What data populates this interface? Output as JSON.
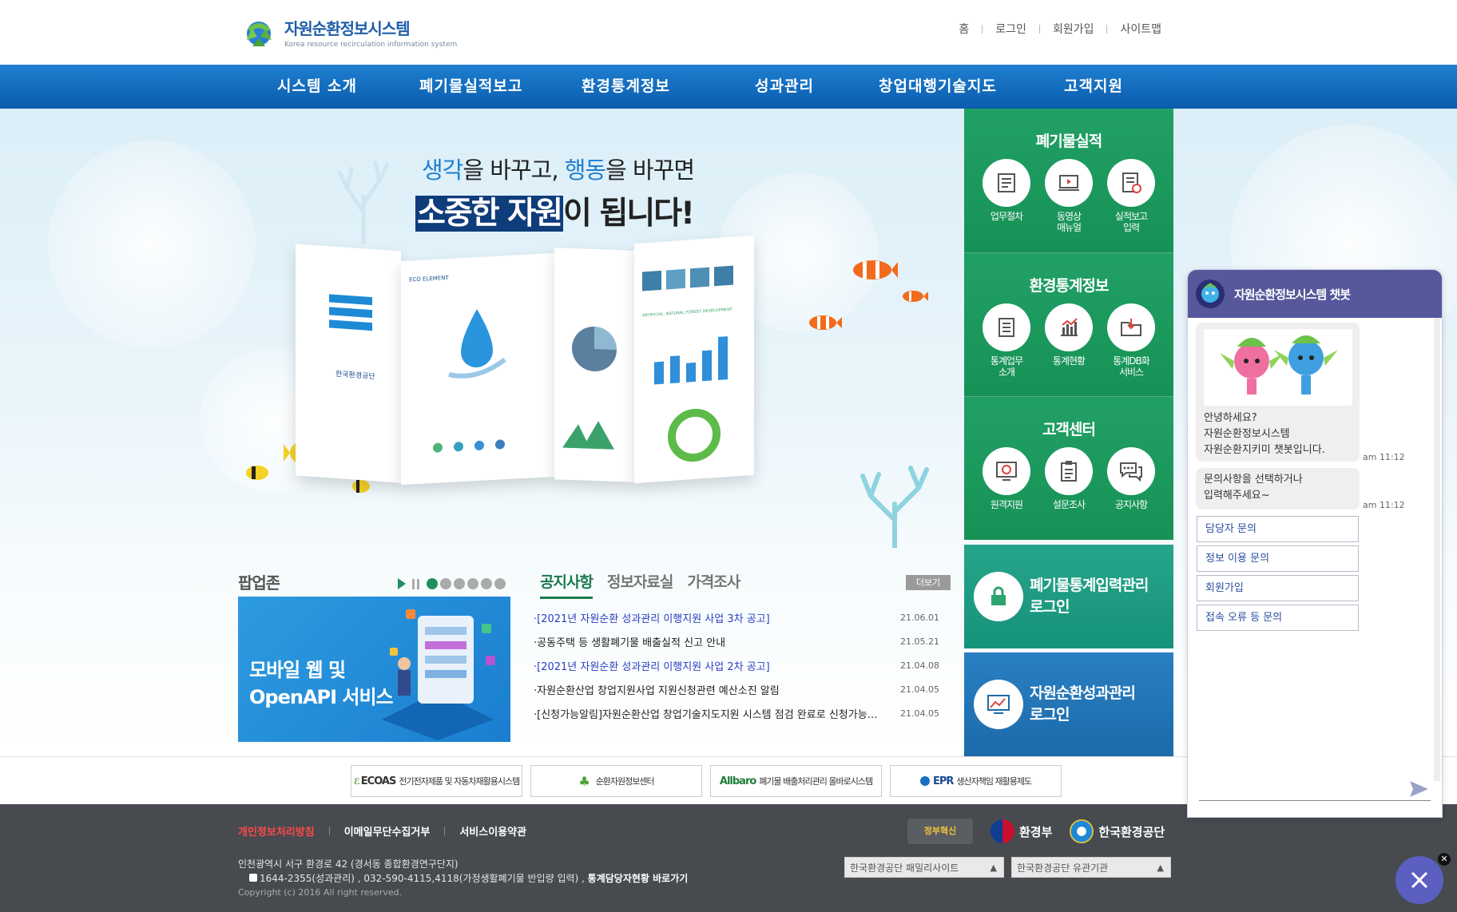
{
  "header": {
    "logo_title": "자원순환정보시스템",
    "logo_subtitle": "Korea resource recirculation information system",
    "util_links": [
      "홈",
      "로그인",
      "회원가입",
      "사이트맵"
    ]
  },
  "gnb": [
    "시스템 소개",
    "폐기물실적보고",
    "환경통계정보",
    "성과관리",
    "창업대행기술지도",
    "고객지원"
  ],
  "hero": {
    "line1_a": "생각",
    "line1_b": "을 바꾸고, ",
    "line1_c": "행동",
    "line1_d": "을 바꾸면",
    "line2_a": "소중한 자원",
    "line2_b": "이 됩니다!",
    "brochure_org": "한국환경공단",
    "brochure_heading": "ECO ELEMENT",
    "brochure_chart_title": "ARTIFICIAL, NATURAL FOREST DEVELOPMENT"
  },
  "quick": {
    "waste": {
      "title": "폐기물실적",
      "items": [
        {
          "label1": "업무절차",
          "label2": "",
          "icon": "document-icon"
        },
        {
          "label1": "동영상",
          "label2": "매뉴얼",
          "icon": "video-icon"
        },
        {
          "label1": "실적보고",
          "label2": "입력",
          "icon": "report-check-icon"
        }
      ]
    },
    "stats": {
      "title": "환경통계정보",
      "items": [
        {
          "label1": "통계업무",
          "label2": "소개",
          "icon": "notebook-icon"
        },
        {
          "label1": "통계현황",
          "label2": "",
          "icon": "bar-chart-icon"
        },
        {
          "label1": "통계DB화",
          "label2": "서비스",
          "icon": "folder-download-icon"
        }
      ]
    },
    "customer": {
      "title": "고객센터",
      "items": [
        {
          "label1": "원격지원",
          "label2": "",
          "icon": "remote-gear-icon"
        },
        {
          "label1": "설문조사",
          "label2": "",
          "icon": "clipboard-icon"
        },
        {
          "label1": "공지사항",
          "label2": "",
          "icon": "chat-bubbles-icon"
        }
      ]
    },
    "login1": {
      "line1": "폐기물통계입력관리",
      "line2": "로그인"
    },
    "login2": {
      "line1": "자원순환성과관리",
      "line2": "로그인"
    }
  },
  "popup": {
    "title": "팝업존",
    "banner_line1": "모바일 웹 및",
    "banner_line2": "OpenAPI 서비스"
  },
  "notice": {
    "tabs": [
      "공지사항",
      "정보자료실",
      "가격조사"
    ],
    "more": "더보기",
    "items": [
      {
        "title": "·[2021년 자원순환 성과관리 이행지원 사업 3차 공고]",
        "date": "21.06.01",
        "new": true
      },
      {
        "title": "·공동주택 등 생활폐기물 배출실적 신고 안내",
        "date": "21.05.21",
        "new": false
      },
      {
        "title": "·[2021년 자원순환 성과관리 이행지원 사업 2차 공고]",
        "date": "21.04.08",
        "new": true
      },
      {
        "title": "·자원순환산업 창업지원사업 지원신청관련 예산소진 알림",
        "date": "21.04.05",
        "new": false
      },
      {
        "title": "·[신청가능알림]자원순환산업 창업기술지도지원 시스템 점검 완료로 신청가능합니다",
        "date": "21.04.05",
        "new": false
      }
    ]
  },
  "family": [
    {
      "name": "ECOAS",
      "desc": "전기전자제품 및 자동차재활용시스템"
    },
    {
      "name": "",
      "desc": "순환자원정보센터"
    },
    {
      "name": "Allbaro",
      "desc": "폐기물 배출처리관리 올바로시스템"
    },
    {
      "name": "EPR",
      "desc": "생산자책임 재활용제도"
    }
  ],
  "footer": {
    "links": [
      "개인정보처리방침",
      "이메일무단수집거부",
      "서비스이용약관"
    ],
    "address": "인천광역시 서구 환경로 42 (경서동 종합환경연구단지)",
    "phone": "1644-2355(성과관리) , 032-590-4115,4118(가정생활폐기물 반입량 입력) , ",
    "phone_link": "통계담당자현황 바로가기",
    "copyright": "Copyright (c) 2016 All right reserved.",
    "select1": "한국환경공단 패밀리사이트",
    "select2": "한국환경공단 유관기관",
    "partner1": "환경부",
    "partner2": "한국환경공단",
    "gov_badge": "정부혁신"
  },
  "chatbot": {
    "title": "자원순환정보시스템 챗봇",
    "greeting1": "안녕하세요?",
    "greeting2": "자원순환정보시스템",
    "greeting3": "자원순환지키미 챗봇입니다.",
    "time1": "am 11:12",
    "prompt1": "문의사항을 선택하거나",
    "prompt2": "입력해주세요~",
    "time2": "am 11:12",
    "options": [
      "담당자 문의",
      "정보 이용 문의",
      "회원가입",
      "접속 오류 등 문의"
    ]
  }
}
